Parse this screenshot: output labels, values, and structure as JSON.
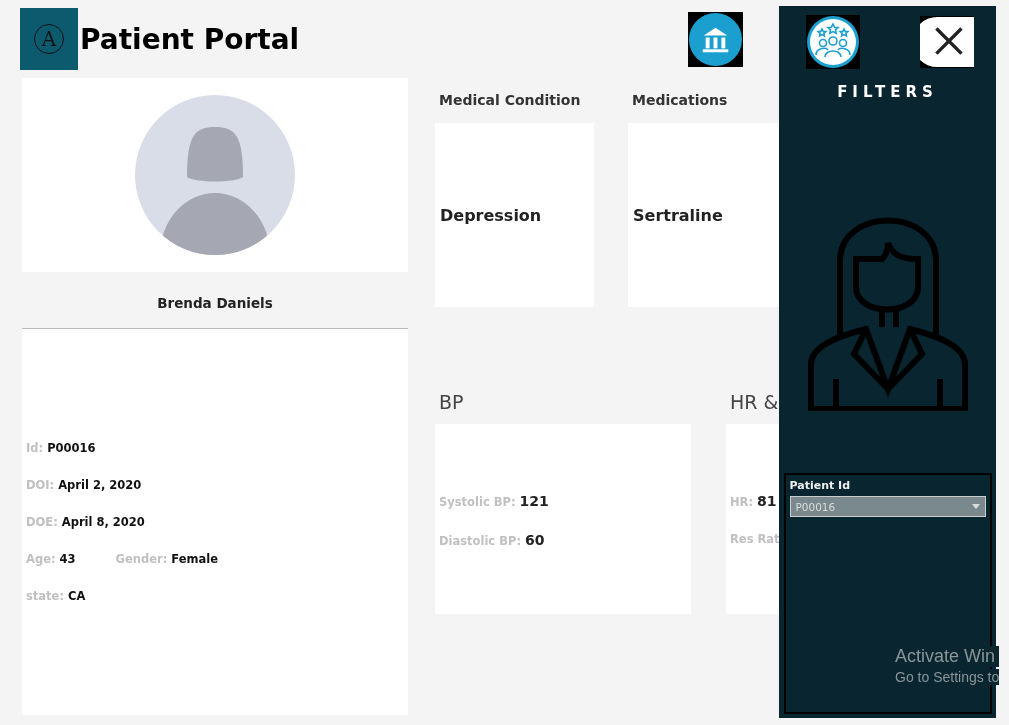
{
  "header": {
    "logo_letter": "A",
    "title": "Patient Portal"
  },
  "patient": {
    "name": "Brenda Daniels",
    "rows": [
      [
        {
          "label": "Id:",
          "value": "P00016"
        }
      ],
      [
        {
          "label": "DOI:",
          "value": "April 2, 2020"
        }
      ],
      [
        {
          "label": "DOE:",
          "value": "April 8, 2020"
        }
      ],
      [
        {
          "label": "Age:",
          "value": "43"
        },
        {
          "label": "Gender:",
          "value": "Female"
        }
      ],
      [
        {
          "label": "state:",
          "value": "CA"
        }
      ]
    ]
  },
  "summary": [
    {
      "title": "Medical Condition",
      "value": "Depression"
    },
    {
      "title": "Medications",
      "value": "Sertraline"
    }
  ],
  "vitals": [
    {
      "title": "BP",
      "items": [
        {
          "label": "Systolic BP:",
          "value": "121"
        },
        {
          "label": "Diastolic BP:",
          "value": "60"
        }
      ]
    },
    {
      "title": "HR &",
      "items": [
        {
          "label": "HR:",
          "value": "81"
        },
        {
          "label": "Res Rat"
        }
      ]
    }
  ],
  "filters": {
    "title": "FILTERS",
    "field_label": "Patient Id",
    "value": "P00016"
  },
  "os_notice": {
    "title": "Activate Win",
    "subtitle": "Go to Settings to"
  }
}
